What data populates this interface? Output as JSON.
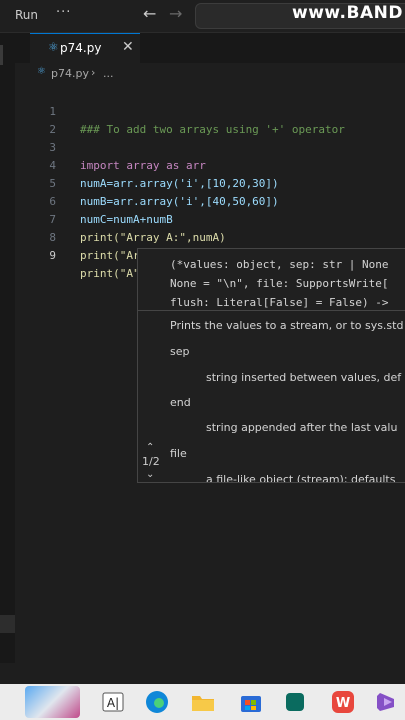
{
  "titlebar": {
    "menu_run": "Run",
    "menu_more": "···",
    "back_icon": "arrow-left",
    "forward_icon": "arrow-right",
    "watermark": "www.BAND"
  },
  "tab": {
    "label": "p74.py",
    "icon": "python-icon",
    "close": "✕"
  },
  "breadcrumb": {
    "file": "p74.py",
    "separator": "›",
    "more": "..."
  },
  "code_lines": [
    {
      "num": "1",
      "text": "### To add two arrays using '+' operator"
    },
    {
      "num": "2",
      "text": ""
    },
    {
      "num": "3",
      "text": "import array as arr"
    },
    {
      "num": "4",
      "text": "numA=arr.array('i',[10,20,30])"
    },
    {
      "num": "5",
      "text": "numB=arr.array('i',[40,50,60])"
    },
    {
      "num": "6",
      "text": "numC=numA+numB"
    },
    {
      "num": "7",
      "text": "print(\"Array A:\",numA)"
    },
    {
      "num": "8",
      "text": "print(\"Array B: \",numB)"
    },
    {
      "num": "9",
      "text": "print(\"A\")"
    }
  ],
  "hover": {
    "signature_line1": "(*values: object, sep: str | None",
    "signature_line2": "None = \"\\n\", file: SupportsWrite[",
    "signature_line3": "flush: Literal[False] = False) ->",
    "summary": "Prints the values to a stream, or to sys.std",
    "params": [
      {
        "name": "sep",
        "desc": "string inserted between values, def"
      },
      {
        "name": "end",
        "desc": "string appended after the last valu"
      },
      {
        "name": "file",
        "desc": "a file-like object (stream); defaults"
      }
    ],
    "overload_count": "1/2"
  },
  "taskbar": {
    "items": [
      {
        "name": "windows-icon",
        "color": "#3a7bd5"
      },
      {
        "name": "cursor-app-icon",
        "color": "#202020"
      },
      {
        "name": "edge-icon",
        "color": "#0f87d8"
      },
      {
        "name": "file-explorer-icon",
        "color": "#f2b630"
      },
      {
        "name": "store-icon",
        "color": "#2a6bd6"
      },
      {
        "name": "wps-office-icon",
        "color": "#e8473d"
      },
      {
        "name": "visual-studio-icon",
        "color": "#8550c6"
      }
    ]
  },
  "colors": {
    "editor_bg": "#1e1e1e",
    "comment": "#6a9955",
    "keyword": "#c586c0",
    "variable": "#9cdcfe",
    "function": "#dcdcaa",
    "string": "#ce9178",
    "number": "#b5cea8",
    "accent": "#0078d4"
  }
}
